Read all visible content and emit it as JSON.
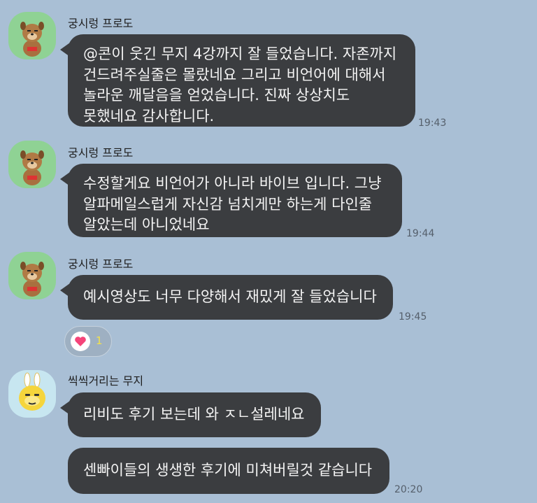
{
  "messages": [
    {
      "sender": "궁시렁 프로도",
      "lines": [
        "@콘이 웃긴 무지 4강까지 잘 들었습니다. 자존까지",
        "건드려주실줄은 몰랐네요 그리고 비언어에 대해서",
        "놀라운 깨달음을 얻었습니다. 진짜 상상치도",
        "못했네요 감사합니다."
      ],
      "time": "19:43"
    },
    {
      "sender": "궁시렁 프로도",
      "lines": [
        "수정할게요 비언어가 아니라 바이브 입니다. 그냥",
        "알파메일스럽게 자신감 넘치게만 하는게 다인줄",
        "알았는데 아니었네요"
      ],
      "time": "19:44"
    },
    {
      "sender": "궁시렁 프로도",
      "lines": [
        "예시영상도 너무 다양해서 재밌게 잘 들었습니다"
      ],
      "time": "19:45",
      "reaction": {
        "icon": "heart-icon",
        "count": "1"
      }
    },
    {
      "sender": "씩씩거리는 무지",
      "lines": [
        "리비도 후기 보는데 와 ㅈㄴ설레네요"
      ]
    },
    {
      "lines": [
        "센빠이들의 생생한 후기에 미쳐버릴것 같습니다"
      ],
      "time": "20:20"
    }
  ],
  "colors": {
    "background": "#a9bfd5",
    "bubble": "#3b3d40",
    "bubble_text": "#f4f4f4",
    "reaction_heart": "#f5457a",
    "reaction_count": "#f3e24a"
  }
}
